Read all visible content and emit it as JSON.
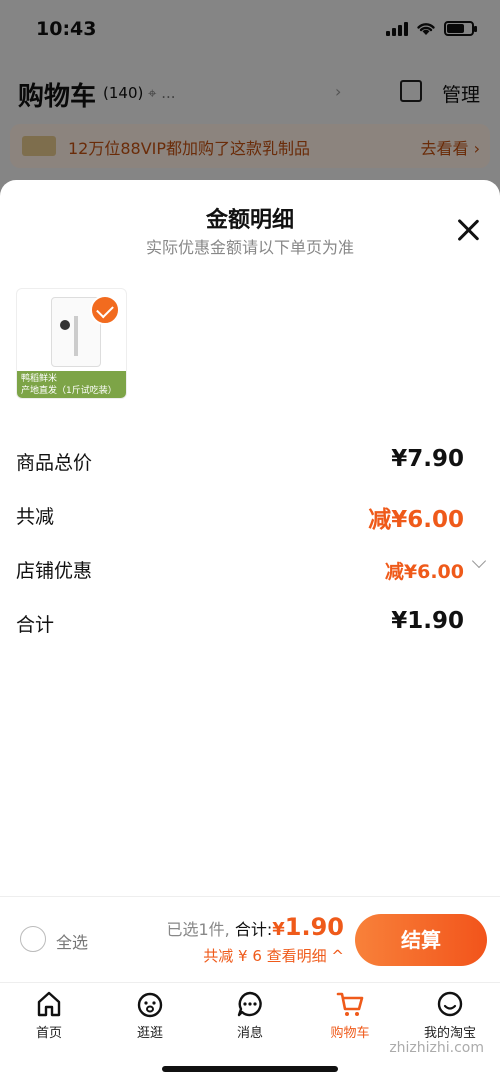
{
  "status": {
    "time": "10:43"
  },
  "cart_header": {
    "title": "购物车",
    "count": "(140)",
    "location": "...",
    "manage": "管理"
  },
  "vip_banner": {
    "text": "12万位88VIP都加购了这款乳制品",
    "link": "去看看 ›"
  },
  "sheet": {
    "title": "金额明细",
    "subtitle": "实际优惠金额请以下单页为准",
    "product": {
      "label_line1": "鸭稻鲜米",
      "label_line2": "产地直发（1斤试吃装）"
    },
    "rows": [
      {
        "label": "商品总价",
        "value": "¥7.90"
      },
      {
        "label": "共减",
        "value": "减¥6.00"
      },
      {
        "label": "店铺优惠",
        "value": "减¥6.00"
      },
      {
        "label": "合计",
        "value": "¥1.90"
      }
    ]
  },
  "summary": {
    "select_all": "全选",
    "selected": "已选1件,",
    "total_label": "合计:",
    "currency": "¥",
    "total_amount": "1.90",
    "discount_detail": "共减 ¥ 6  查看明细 ^",
    "checkout": "结算"
  },
  "tabbar": {
    "items": [
      {
        "label": "首页",
        "icon": "home-icon"
      },
      {
        "label": "逛逛",
        "icon": "browse-icon"
      },
      {
        "label": "消息",
        "icon": "message-icon"
      },
      {
        "label": "购物车",
        "icon": "cart-icon"
      },
      {
        "label": "我的淘宝",
        "icon": "profile-icon"
      }
    ]
  },
  "colors": {
    "accent": "#ef5a1a",
    "product_label": "#7da447"
  },
  "watermark": "zhizhizhi.com"
}
